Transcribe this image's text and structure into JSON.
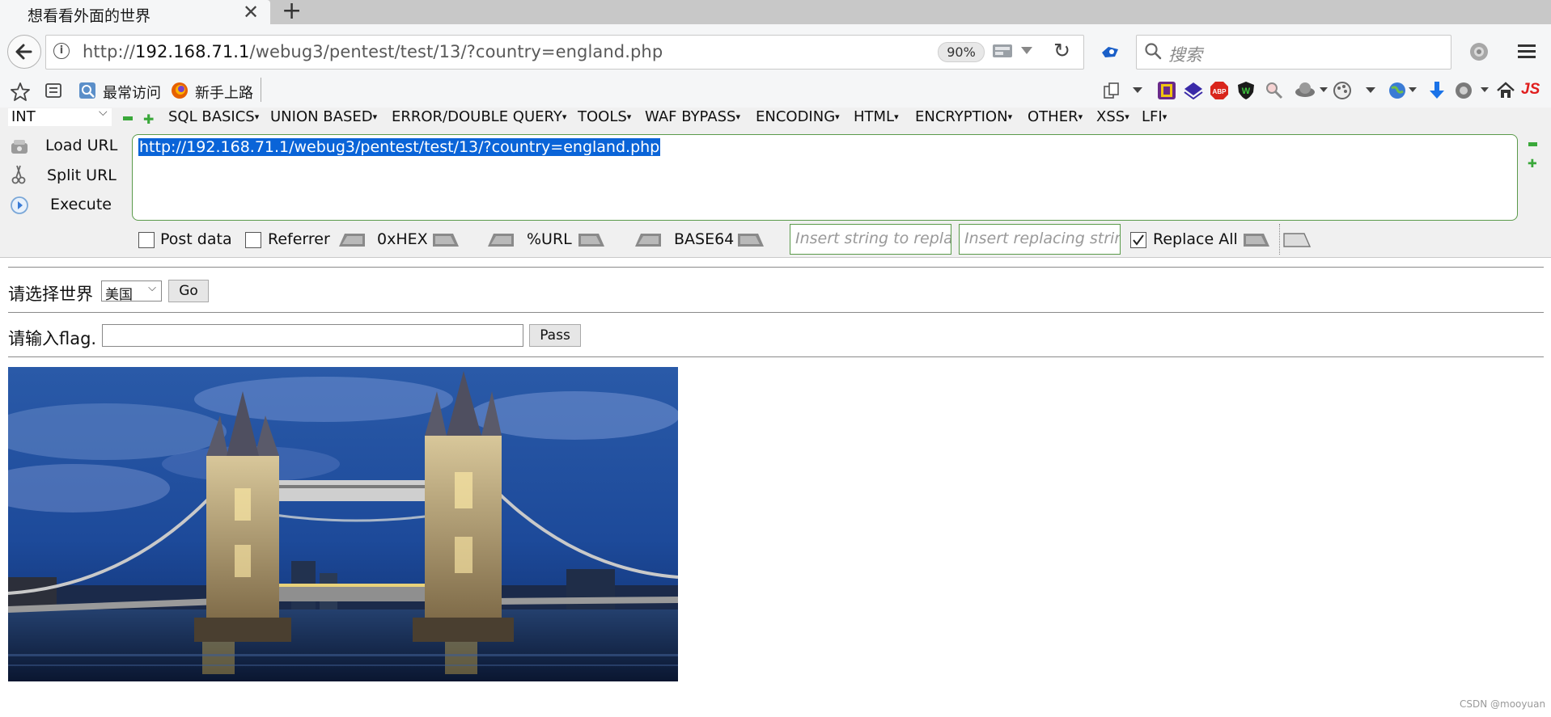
{
  "browser": {
    "tab_title": "想看看外面的世界",
    "url_prefix": "http://",
    "url_host": "192.168.71.1",
    "url_path": "/webug3/pentest/test/13/?country=england.php",
    "zoom": "90%",
    "search_placeholder": "搜索"
  },
  "bookmarks": {
    "items": [
      {
        "label": "最常访问",
        "icon": "most-visited-icon"
      },
      {
        "label": "新手上路",
        "icon": "firefox-icon"
      }
    ]
  },
  "hackbar": {
    "type_select": "INT",
    "menus": [
      "SQL BASICS",
      "UNION BASED",
      "ERROR/DOUBLE QUERY",
      "TOOLS",
      "WAF BYPASS",
      "ENCODING",
      "HTML",
      "ENCRYPTION",
      "OTHER",
      "XSS",
      "LFI"
    ],
    "actions": {
      "load_url": "Load URL",
      "split_url": "Split URL",
      "execute": "Execute"
    },
    "url_value": "http://192.168.71.1/webug3/pentest/test/13/?country=england.php",
    "post_data_label": "Post data",
    "referrer_label": "Referrer",
    "encoders": [
      "0xHEX",
      "%URL",
      "BASE64"
    ],
    "replace_from_placeholder": "Insert string to replace",
    "replace_to_placeholder": "Insert replacing string",
    "replace_all_label": "Replace All",
    "replace_all_checked": true
  },
  "page": {
    "world_label": "请选择世界",
    "country_selected": "美国",
    "go_label": "Go",
    "flag_label": "请输入flag.",
    "flag_value": "",
    "pass_label": "Pass"
  },
  "watermark": "CSDN @mooyuan"
}
